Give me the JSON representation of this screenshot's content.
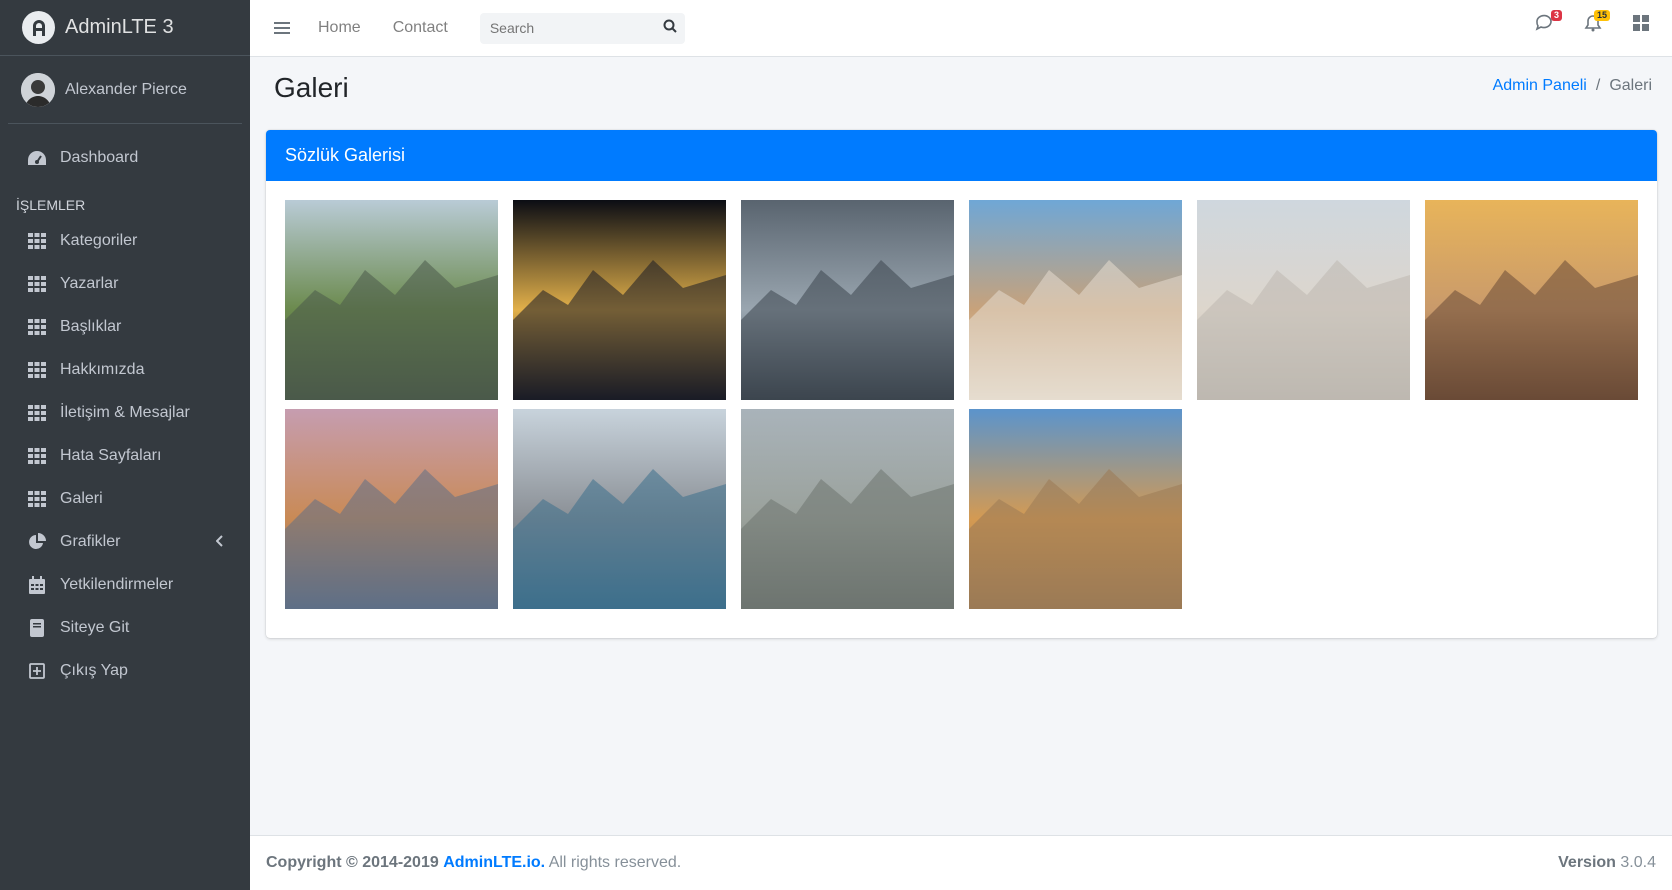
{
  "brand": {
    "name": "AdminLTE 3"
  },
  "user": {
    "name": "Alexander Pierce"
  },
  "sidebar": {
    "dashboard": "Dashboard",
    "section_header": "İŞLEMLER",
    "items": [
      {
        "label": "Kategoriler",
        "icon": "grid-icon"
      },
      {
        "label": "Yazarlar",
        "icon": "grid-icon"
      },
      {
        "label": "Başlıklar",
        "icon": "grid-icon"
      },
      {
        "label": "Hakkımızda",
        "icon": "grid-icon"
      },
      {
        "label": "İletişim & Mesajlar",
        "icon": "grid-icon"
      },
      {
        "label": "Hata Sayfaları",
        "icon": "grid-icon"
      },
      {
        "label": "Galeri",
        "icon": "grid-icon"
      },
      {
        "label": "Grafikler",
        "icon": "pie-chart-icon"
      },
      {
        "label": "Yetkilendirmeler",
        "icon": "calendar-icon"
      },
      {
        "label": "Siteye Git",
        "icon": "book-icon"
      },
      {
        "label": "Çıkış Yap",
        "icon": "plus-square-icon"
      }
    ]
  },
  "topbar": {
    "home": "Home",
    "contact": "Contact",
    "search_placeholder": "Search",
    "messages_count": "3",
    "notifications_count": "15"
  },
  "page": {
    "title": "Galeri",
    "breadcrumb_home": "Admin Paneli",
    "breadcrumb_current": "Galeri"
  },
  "card": {
    "title": "Sözlük Galerisi",
    "photos": [
      {
        "name": "amsterdam-canal-photo",
        "sky": "#b9cbd6",
        "ground": "#4b5a4a",
        "accent": "#6b8a4d"
      },
      {
        "name": "berlin-night-photo",
        "sky": "#0b0d14",
        "ground": "#1a1c26",
        "accent": "#e2b04a"
      },
      {
        "name": "stockholm-snow-photo",
        "sky": "#59646f",
        "ground": "#3c454e",
        "accent": "#9aa6b0"
      },
      {
        "name": "lisbon-square-photo",
        "sky": "#6fa7d6",
        "ground": "#e6ddcf",
        "accent": "#c8a27a"
      },
      {
        "name": "milan-cathedral-photo",
        "sky": "#cfd7de",
        "ground": "#bdb8b0",
        "accent": "#ddd6cc"
      },
      {
        "name": "madrid-skyline-photo",
        "sky": "#e8b45a",
        "ground": "#6a4a36",
        "accent": "#c99a6b"
      },
      {
        "name": "moscow-kremlin-photo",
        "sky": "#c69db0",
        "ground": "#5e6f86",
        "accent": "#c98a55"
      },
      {
        "name": "new-york-aerial-photo",
        "sky": "#c8d3dc",
        "ground": "#3d6f8c",
        "accent": "#8a8f95"
      },
      {
        "name": "paris-aerial-photo",
        "sky": "#a9b3ba",
        "ground": "#6d7470",
        "accent": "#9aa19b"
      },
      {
        "name": "colosseum-photo",
        "sky": "#5b94cc",
        "ground": "#9b7a55",
        "accent": "#d49a52"
      }
    ]
  },
  "footer": {
    "copyright": "Copyright © 2014-2019",
    "link": "AdminLTE.io.",
    "rights": "All rights reserved.",
    "version_label": "Version",
    "version": "3.0.4"
  }
}
